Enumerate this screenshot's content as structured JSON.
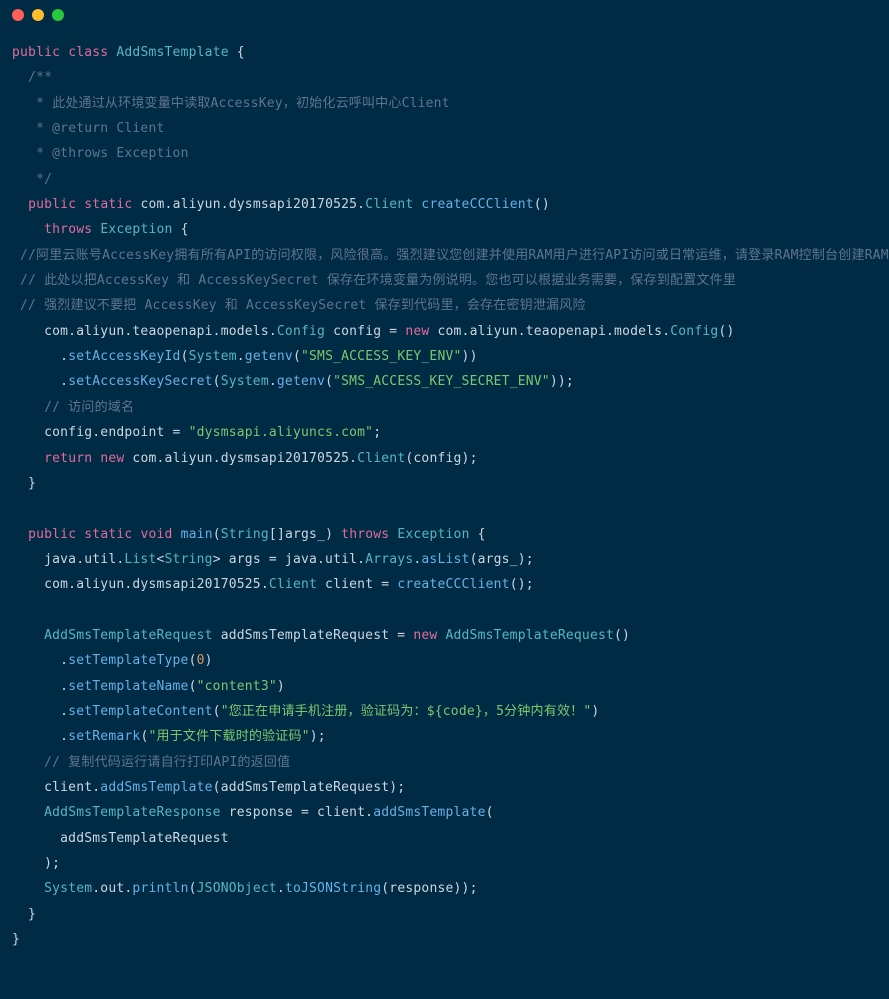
{
  "titlebar": {
    "close": "close",
    "minimize": "minimize",
    "maximize": "maximize"
  },
  "code": {
    "t1": "public",
    "t2": "class",
    "t3": "AddSmsTemplate",
    "t4": " {",
    "c1": "  /**",
    "c2": "   * 此处通过从环境变量中读取AccessKey，初始化云呼叫中心Client",
    "c3": "   * ",
    "c3a": "@return",
    "c3b": " Client",
    "c4": "   * ",
    "c4a": "@throws",
    "c4b": " Exception",
    "c5": "   */",
    "m1a": "public",
    "m1b": "static",
    "m1c": " com.aliyun.dysmsapi20170525.",
    "m1d": "Client",
    "m1e": "createCCClient",
    "m1f": "()",
    "m2a": "throws",
    "m2b": "Exception",
    "m2c": " {",
    "cc1": " //阿里云账号AccessKey拥有所有API的访问权限，风险很高。强烈建议您创建并使用RAM用户进行API访问或日常运维，请登录RAM控制台创建RAM用户",
    "cc2": " // 此处以把AccessKey 和 AccessKeySecret 保存在环境变量为例说明。您也可以根据业务需要，保存到配置文件里",
    "cc3": " // 强烈建议不要把 AccessKey 和 AccessKeySecret 保存到代码里，会存在密钥泄漏风险",
    "l1a": "    com.aliyun.teaopenapi.models.",
    "l1b": "Config",
    "l1c": " config = ",
    "l1d": "new",
    "l1e": " com.aliyun.teaopenapi.models.",
    "l1f": "Config",
    "l1g": "()",
    "l2a": "      .",
    "l2b": "setAccessKeyId",
    "l2c": "(",
    "l2d": "System",
    "l2e": ".",
    "l2f": "getenv",
    "l2g": "(",
    "l2h": "\"SMS_ACCESS_KEY_ENV\"",
    "l2i": "))",
    "l3a": "      .",
    "l3b": "setAccessKeySecret",
    "l3c": "(",
    "l3d": "System",
    "l3e": ".",
    "l3f": "getenv",
    "l3g": "(",
    "l3h": "\"SMS_ACCESS_KEY_SECRET_ENV\"",
    "l3i": "));",
    "cc4": "    // 访问的域名",
    "l4a": "    config.endpoint = ",
    "l4b": "\"dysmsapi.aliyuncs.com\"",
    "l4c": ";",
    "l5a": "return",
    "l5b": "new",
    "l5c": " com.aliyun.dysmsapi20170525.",
    "l5d": "Client",
    "l5e": "(config);",
    "l6": "  }",
    "bl": "",
    "m3a": "public",
    "m3b": "static",
    "m3c": "void",
    "m3d": "main",
    "m3e": "(",
    "m3f": "String",
    "m3g": "[]args_) ",
    "m3h": "throws",
    "m3i": "Exception",
    "m3j": " {",
    "l7a": "    java.util.",
    "l7b": "List",
    "l7c": "<",
    "l7d": "String",
    "l7e": "> args = java.util.",
    "l7f": "Arrays",
    "l7g": ".",
    "l7h": "asList",
    "l7i": "(args_);",
    "l8a": "    com.aliyun.dysmsapi20170525.",
    "l8b": "Client",
    "l8c": " client = ",
    "l8d": "createCCClient",
    "l8e": "();",
    "l9a": "AddSmsTemplateRequest",
    "l9b": " addSmsTemplateRequest = ",
    "l9c": "new",
    "l9d": "AddSmsTemplateRequest",
    "l9e": "()",
    "l10a": "      .",
    "l10b": "setTemplateType",
    "l10c": "(",
    "l10d": "0",
    "l10e": ")",
    "l11a": "      .",
    "l11b": "setTemplateName",
    "l11c": "(",
    "l11d": "\"content3\"",
    "l11e": ")",
    "l12a": "      .",
    "l12b": "setTemplateContent",
    "l12c": "(",
    "l12d": "\"您正在申请手机注册，验证码为：${code}，5分钟内有效！\"",
    "l12e": ")",
    "l13a": "      .",
    "l13b": "setRemark",
    "l13c": "(",
    "l13d": "\"用于文件下载时的验证码\"",
    "l13e": ");",
    "cc5": "    // 复制代码运行请自行打印API的返回值",
    "l14a": "    client.",
    "l14b": "addSmsTemplate",
    "l14c": "(addSmsTemplateRequest);",
    "l15a": "AddSmsTemplateResponse",
    "l15b": " response = client.",
    "l15c": "addSmsTemplate",
    "l15d": "(",
    "l16": "      addSmsTemplateRequest",
    "l17": "    );",
    "l18a": "System",
    "l18b": ".out.",
    "l18c": "println",
    "l18d": "(",
    "l18e": "JSONObject",
    "l18f": ".",
    "l18g": "toJSONString",
    "l18h": "(response));",
    "l19": "  }",
    "l20": "}"
  }
}
